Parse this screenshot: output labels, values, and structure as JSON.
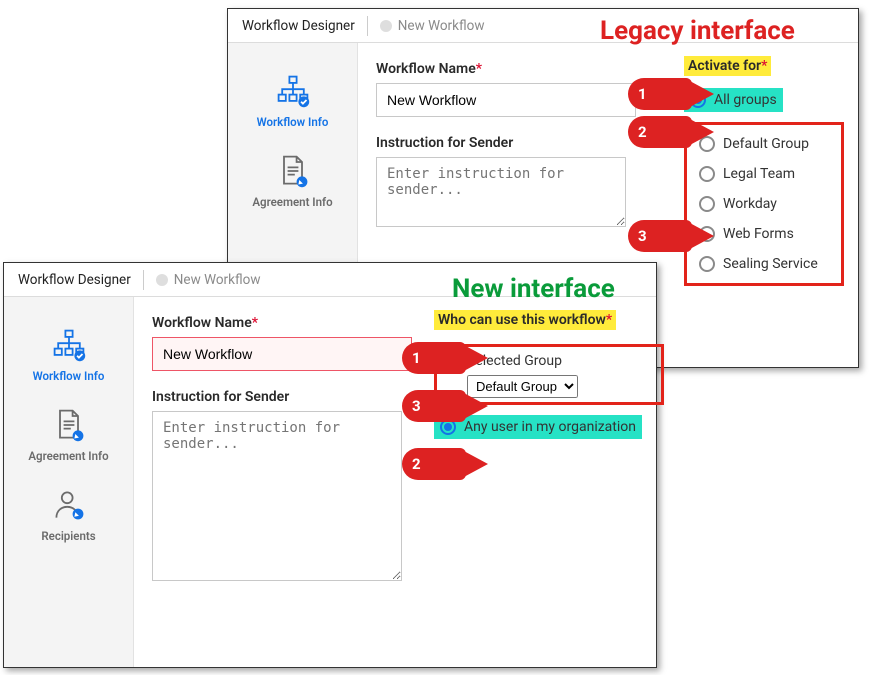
{
  "banners": {
    "legacy": "Legacy interface",
    "new_": "New interface"
  },
  "header": {
    "title": "Workflow Designer",
    "sub": "New Workflow"
  },
  "sidebar": {
    "items": [
      {
        "label": "Workflow Info"
      },
      {
        "label": "Agreement Info"
      },
      {
        "label": "Recipients"
      }
    ]
  },
  "labels": {
    "workflow_name": "Workflow Name",
    "instruction": "Instruction for Sender",
    "activate_for": "Activate for",
    "who_can": "Who can use this workflow"
  },
  "fields": {
    "name_value": "New Workflow",
    "instruction_placeholder": "Enter instruction for sender..."
  },
  "legacy": {
    "selected": "All groups",
    "options": [
      "Default Group",
      "Legal Team",
      "Workday",
      "Web Forms",
      "Sealing Service"
    ]
  },
  "new_": {
    "selected_group_label": "Selected Group",
    "dropdown_value": "Default Group",
    "any_user": "Any user in my organization"
  },
  "callouts": {
    "c1": "1",
    "c2": "2",
    "c3": "3"
  }
}
